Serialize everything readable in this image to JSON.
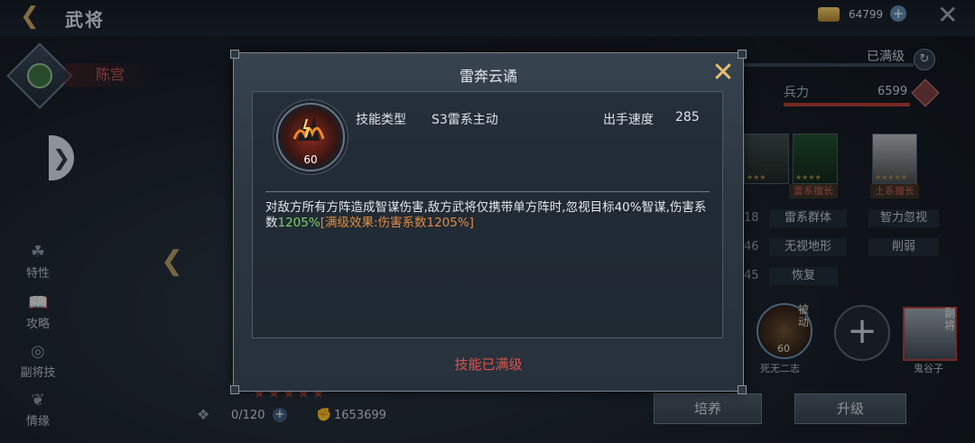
{
  "header": {
    "title": "武将",
    "gold": "64799"
  },
  "hero": {
    "name": "陈宫"
  },
  "side_menu": [
    {
      "label": "特性"
    },
    {
      "label": "攻略"
    },
    {
      "label": "副将技"
    },
    {
      "label": "情缘"
    }
  ],
  "stats_panel": {
    "max_level_label": "已满级",
    "troop_label": "兵力",
    "troop_value": "6599"
  },
  "skill_cards": [
    {
      "label": "雷系擅长"
    },
    {
      "label": "土系擅长"
    }
  ],
  "stat_rows": [
    {
      "num": "18",
      "tag1": "雷系群体",
      "tag2": "智力忽视"
    },
    {
      "num": "46",
      "tag1": "无视地形",
      "tag2": "削弱"
    },
    {
      "num": "45",
      "tag1": "恢复",
      "tag2": ""
    }
  ],
  "passive": {
    "tag": "被动",
    "level": "60",
    "name": "死无二志"
  },
  "deputy": {
    "tag": "副将",
    "name": "鬼谷子"
  },
  "bottom": {
    "fragments": "0/120",
    "power": "1653699",
    "cultivate": "培养",
    "upgrade": "升级"
  },
  "modal": {
    "title": "雷奔云谲",
    "skill_level": "60",
    "type_label": "技能类型",
    "type_value": "S3雷系主动",
    "speed_label": "出手速度",
    "speed_value": "285",
    "desc_main": "对敌方所有方阵造成智谋伤害,敌方武将仅携带单方阵时,忽视目标40%智谋,伤害系数",
    "desc_coef": "1205%",
    "desc_max": "[满级效果:伤害系数1205%]",
    "footer": "技能已满级"
  },
  "colors": {
    "accent_gold": "#e6c06d",
    "warn_red": "#e0524a",
    "green_value": "#7fce6a",
    "orange_value": "#e08a3e"
  }
}
